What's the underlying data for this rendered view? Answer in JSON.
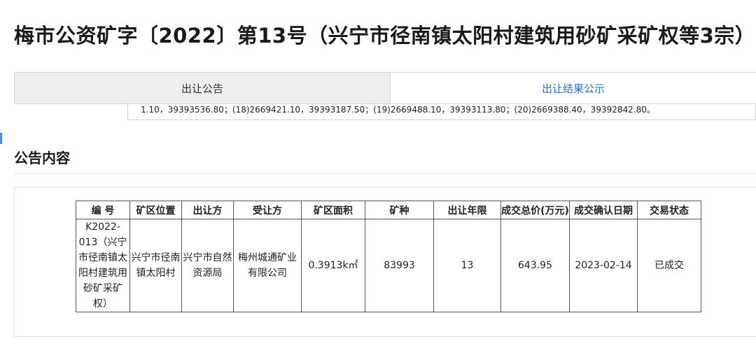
{
  "page": {
    "title": "梅市公资矿字〔2022〕第13号（兴宁市径南镇太阳村建筑用砂矿采矿权等3宗）"
  },
  "tabs": [
    {
      "label": "出让公告",
      "active": false
    },
    {
      "label": "出让结果公示",
      "active": true
    }
  ],
  "coords_text": "1.10，39393536.80；(18)2669421.10，39393187.50；(19)2669488.10，39393113.80；(20)2669388.40，39392842.80。",
  "section": {
    "title": "公告内容"
  },
  "table": {
    "headers": [
      "编 号",
      "矿区位置",
      "出让方",
      "受让方",
      "矿区面积",
      "矿种",
      "出让年限",
      "成交总价(万元)",
      "成交确认日期",
      "交易状态"
    ],
    "rows": [
      {
        "code": "K2022-013（兴宁市径南镇太阳村建筑用砂矿采矿权）",
        "location": "兴宁市径南镇太阳村",
        "transferor": "兴宁市自然资源局",
        "transferee": "梅州城通矿业有限公司",
        "area": "0.3913k㎡",
        "mineral": "83993",
        "years": "13",
        "total_price": "643.95",
        "confirm_date": "2023-02-14",
        "status": "已成交"
      }
    ]
  },
  "colors": {
    "active_tab_text": "#2a6fd6",
    "inactive_tab_bg": "#eeeeee",
    "accent": "#4a8df0"
  }
}
